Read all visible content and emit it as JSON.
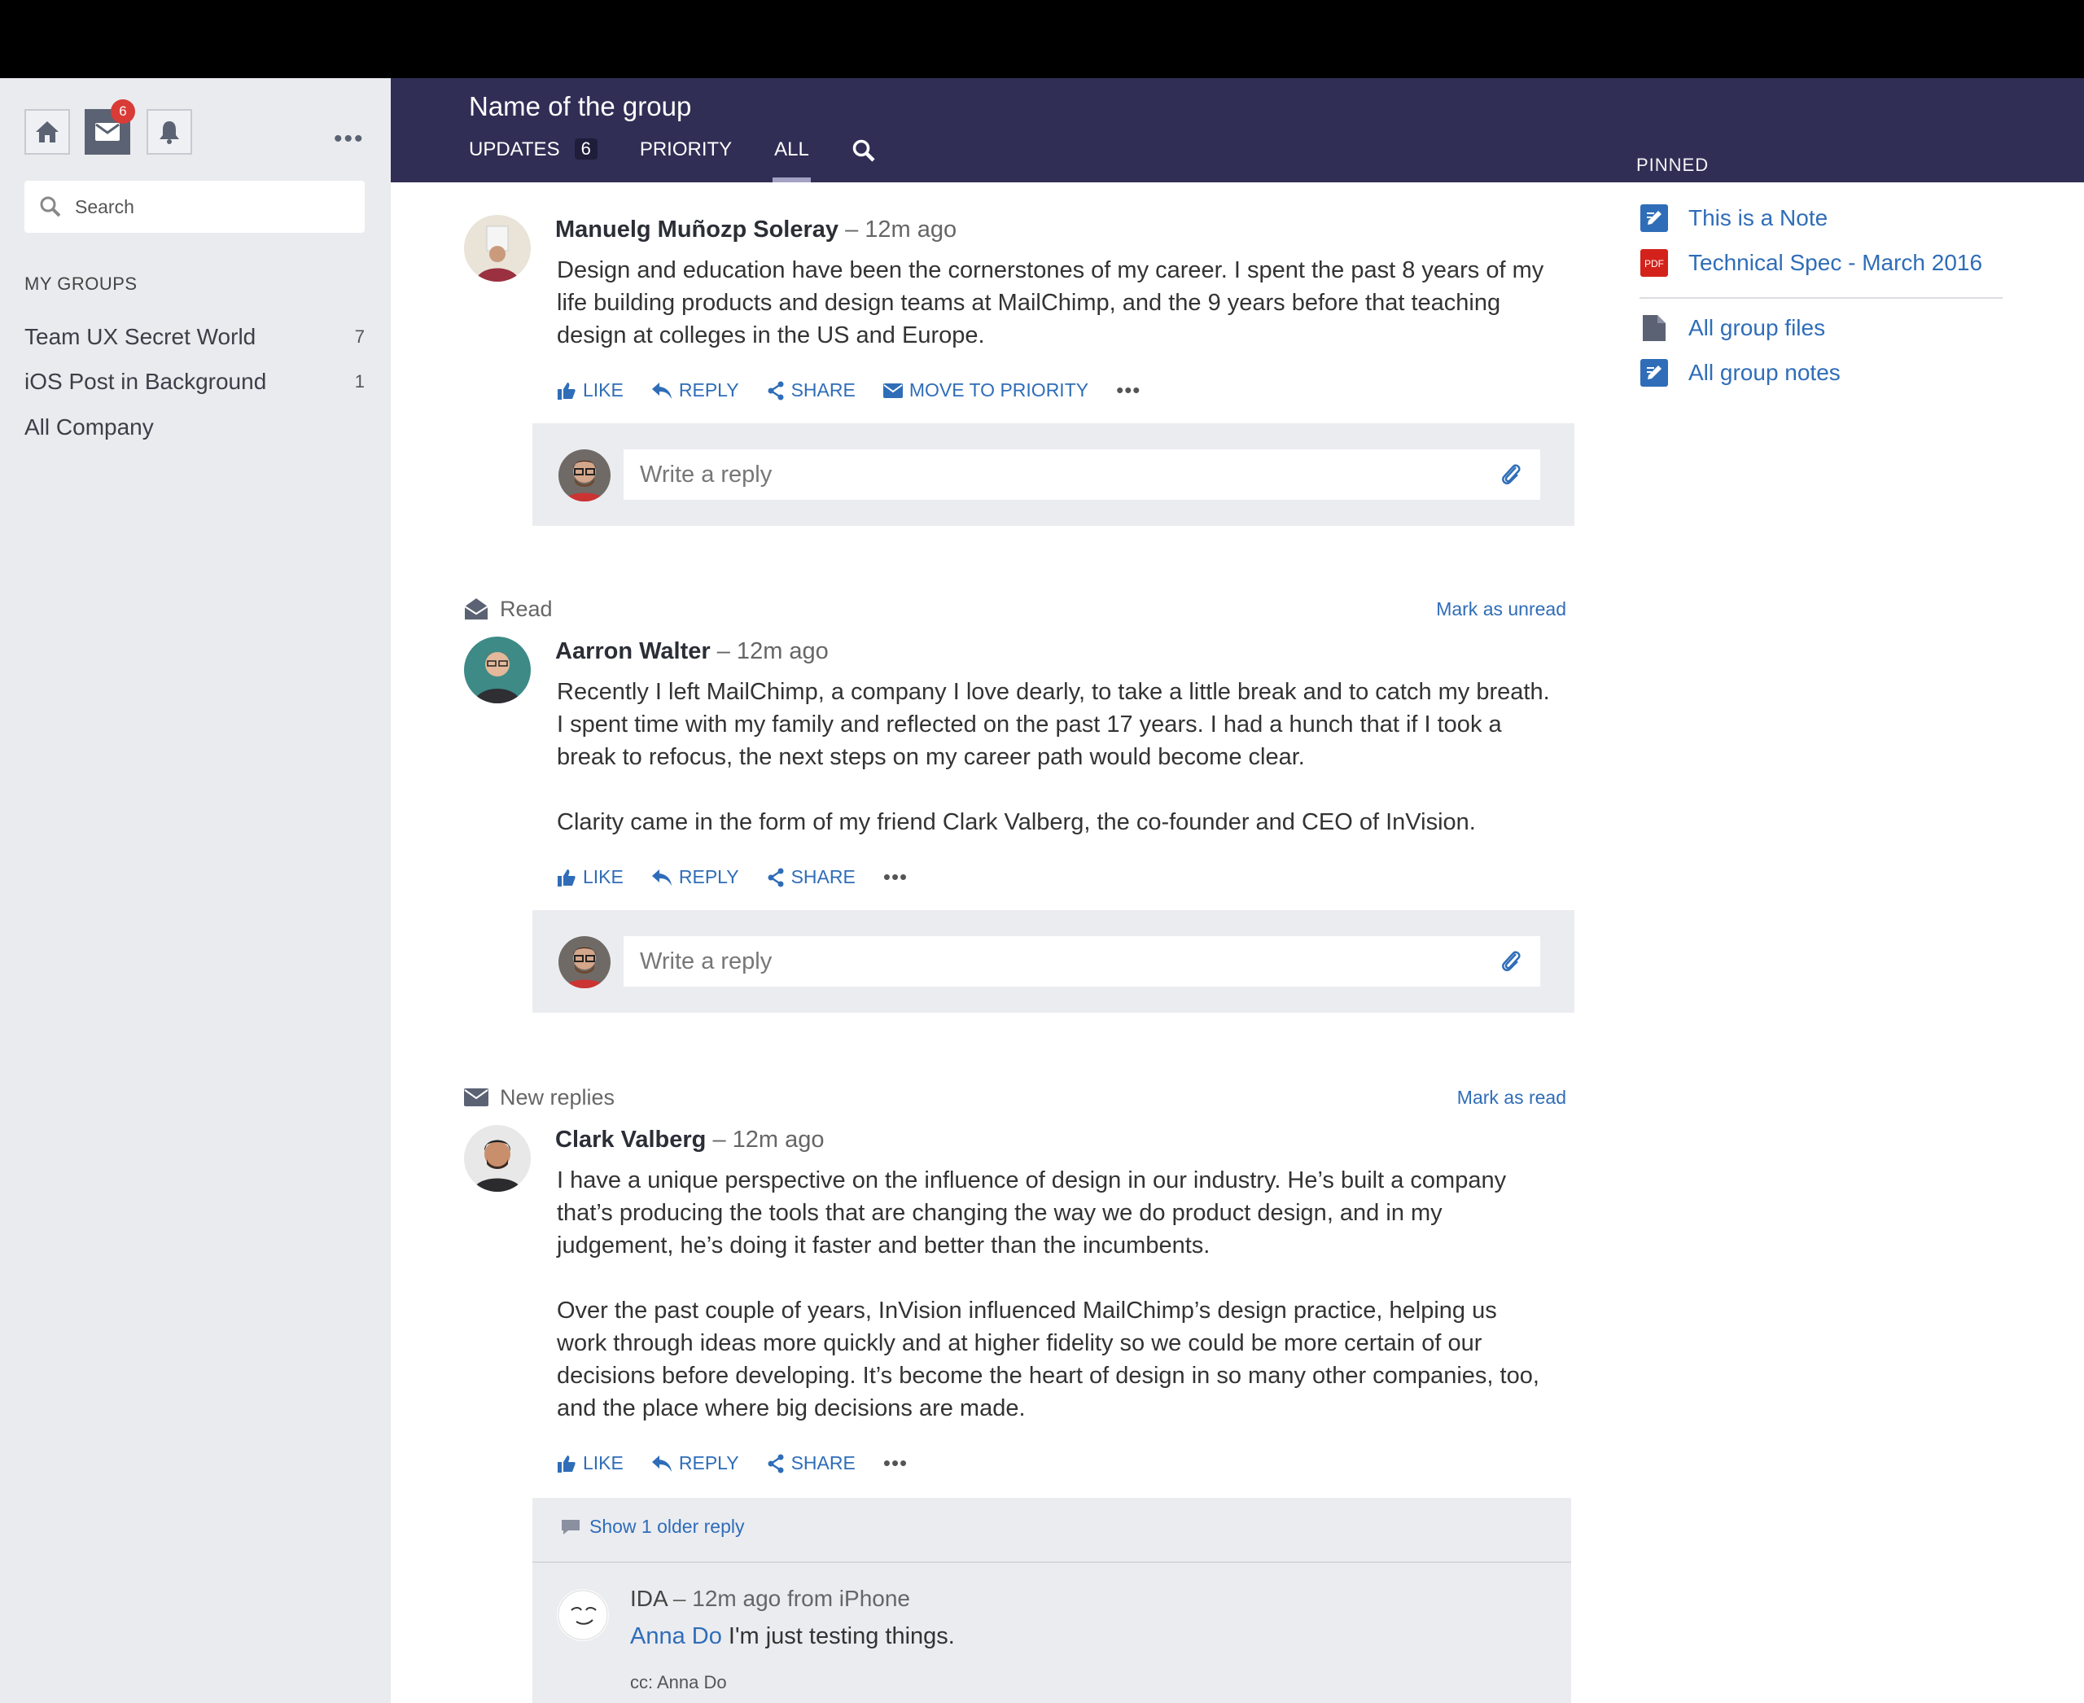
{
  "sidebar": {
    "notification_badge": "6",
    "more_label": "•••",
    "search_placeholder": "Search",
    "groups_title": "MY GROUPS",
    "groups": [
      {
        "label": "Team UX Secret World",
        "count": "7"
      },
      {
        "label": "iOS Post in Background",
        "count": "1"
      },
      {
        "label": "All Company",
        "count": ""
      }
    ]
  },
  "header": {
    "group_name": "Name of the group",
    "tabs": [
      {
        "label": "UPDATES",
        "count": "6"
      },
      {
        "label": "PRIORITY"
      },
      {
        "label": "ALL",
        "active": true
      }
    ]
  },
  "pinned": {
    "label": "PINNED",
    "items": [
      {
        "label": "This is a Note",
        "icon": "note-icon"
      },
      {
        "label": "Technical Spec - March 2016",
        "icon": "pdf-icon",
        "icon_text": "PDF"
      }
    ],
    "links": [
      {
        "label": "All group files",
        "icon": "file-icon"
      },
      {
        "label": "All group notes",
        "icon": "note-icon"
      }
    ]
  },
  "actions": {
    "like": "LIKE",
    "reply": "REPLY",
    "share": "SHARE",
    "move_to_priority": "MOVE TO PRIORITY",
    "more": "•••",
    "reply_placeholder": "Write a reply"
  },
  "posts": [
    {
      "author": "Manuelg Muñozp Soleray",
      "time": "– 12m ago",
      "body": "Design and education have been the cornerstones of my career. I spent the past 8 years of my life building products and design teams at MailChimp, and the 9 years before that teaching design at colleges in the US and Europe."
    },
    {
      "status": "Read",
      "status_action": "Mark as unread",
      "author": "Aarron Walter",
      "time": "– 12m ago",
      "body": "Recently I left MailChimp, a company I love dearly, to take a little break and to catch my breath. I spent time with my family and reflected on the past 17 years. I had a hunch that if I took a break to refocus, the next steps on my career path would become clear.\n\nClarity came in the form of my friend Clark Valberg, the co-founder and CEO of InVision."
    },
    {
      "status": "New replies",
      "status_action": "Mark as read",
      "author": "Clark Valberg",
      "time": "– 12m ago",
      "body": "I have a unique perspective on the influence of design in our industry. He’s built a company that’s producing the tools that are changing the way we do product design, and in my judgement, he’s doing it faster and better than the incumbents.\n\nOver the past couple of years, InVision influenced MailChimp’s design practice, helping us work through ideas more quickly and at higher fidelity so we could be more certain of our decisions before developing. It’s become the heart of design in so many other companies, too, and the place where big decisions are made.",
      "thread": {
        "older_label": "Show 1 older reply",
        "reply_author": "IDA",
        "reply_time": "– 12m ago from iPhone",
        "mention": "Anna Do",
        "reply_text": " I'm just testing things.",
        "cc": "cc: Anna Do"
      }
    }
  ],
  "colors": {
    "header_bg": "#302e55",
    "link": "#2f6db8",
    "sidebar_bg": "#eaebee",
    "badge": "#d93b36"
  }
}
